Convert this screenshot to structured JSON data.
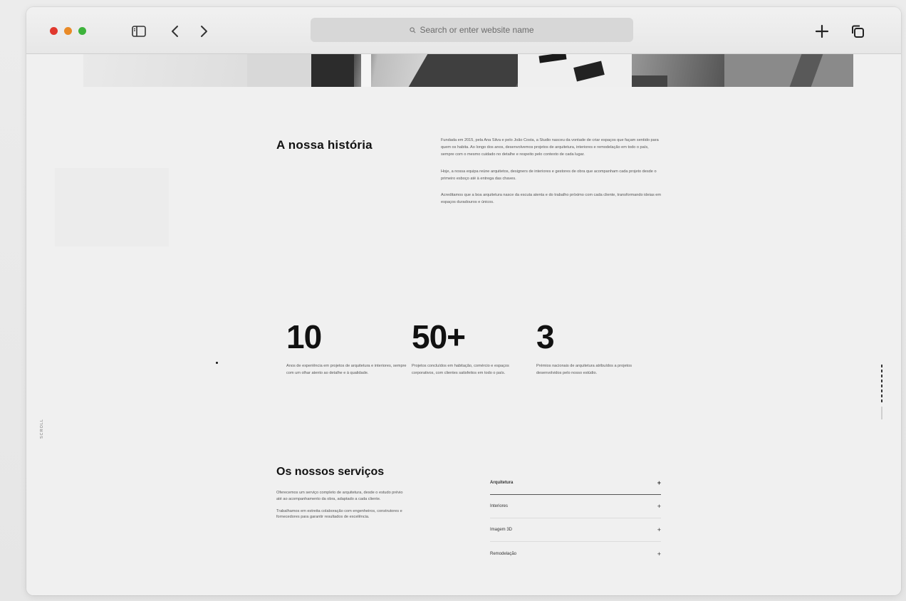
{
  "browser": {
    "url_placeholder": "Search or enter website name"
  },
  "story": {
    "title": "A nossa história",
    "paragraphs": [
      "Fundada em 2015, pela Ana Silva e pelo João Costa, a Studio nasceu da vontade de criar espaços que façam sentido para quem os habita. Ao longo dos anos, desenvolvemos projetos de arquitetura, interiores e remodelação em todo o país, sempre com o mesmo cuidado no detalhe e respeito pelo contexto de cada lugar.",
      "Hoje, a nossa equipa reúne arquitetos, designers de interiores e gestores de obra que acompanham cada projeto desde o primeiro esboço até à entrega das chaves.",
      "Acreditamos que a boa arquitetura nasce da escuta atenta e do trabalho próximo com cada cliente, transformando ideias em espaços duradouros e únicos."
    ]
  },
  "stats": [
    {
      "number": "10",
      "desc": "Anos de experiência em projetos de arquitetura e interiores, sempre com um olhar atento ao detalhe e à qualidade."
    },
    {
      "number": "50+",
      "desc": "Projetos concluídos em habitação, comércio e espaços corporativos, com clientes satisfeitos em todo o país."
    },
    {
      "number": "3",
      "desc": "Prémios nacionais de arquitetura atribuídos a projetos desenvolvidos pelo nosso estúdio."
    }
  ],
  "side_label": "SCROLL",
  "services": {
    "title": "Os nossos serviços",
    "paragraphs": [
      "Oferecemos um serviço completo de arquitetura, desde o estudo prévio até ao acompanhamento da obra, adaptado a cada cliente.",
      "Trabalhamos em estreita colaboração com engenheiros, construtores e fornecedores para garantir resultados de excelência."
    ],
    "items": [
      {
        "label": "Arquitetura",
        "icon": "plus-icon"
      },
      {
        "label": "Interiores",
        "icon": "plus-icon"
      },
      {
        "label": "Imagem 3D",
        "icon": "plus-icon"
      },
      {
        "label": "Remodelação",
        "icon": "plus-icon"
      }
    ]
  }
}
